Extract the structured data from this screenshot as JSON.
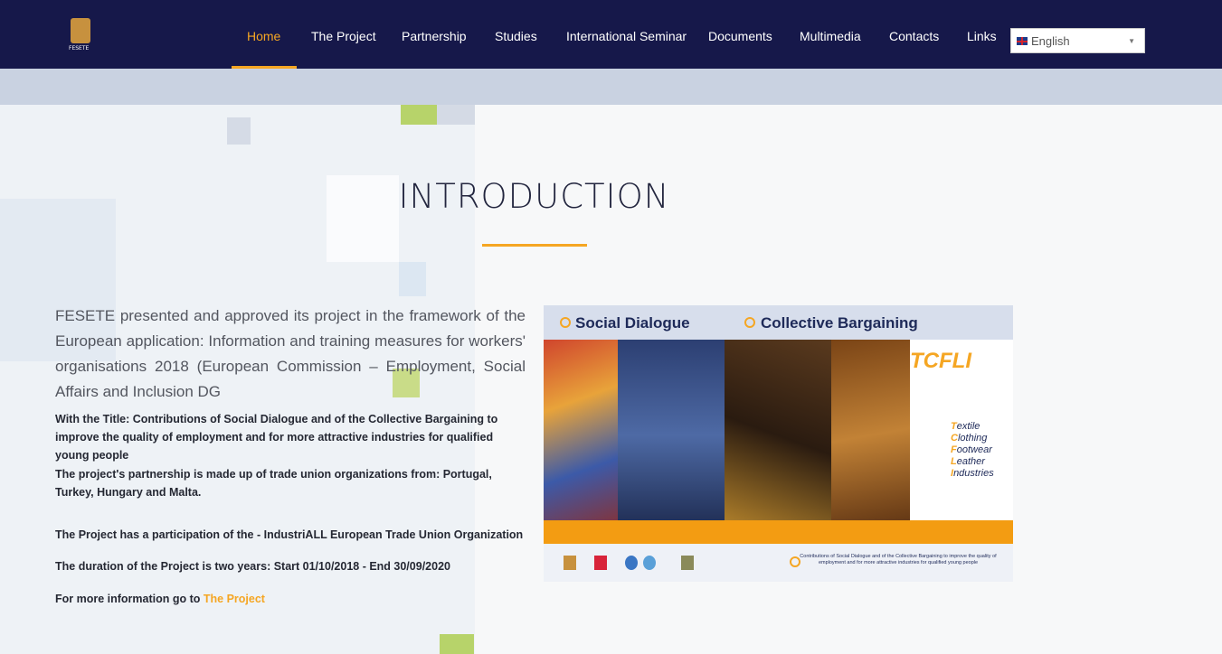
{
  "header": {
    "logo_text": "FESETE",
    "nav": [
      {
        "label": "Home",
        "active": true
      },
      {
        "label": "The Project"
      },
      {
        "label": "Partnership"
      },
      {
        "label": "Studies"
      },
      {
        "label": "International Seminar"
      },
      {
        "label": "Documents"
      },
      {
        "label": "Multimedia"
      },
      {
        "label": "Contacts"
      },
      {
        "label": "Links"
      }
    ],
    "language": {
      "selected": "English",
      "icon": "uk-flag-icon"
    }
  },
  "main": {
    "title": "INTRODUCTION",
    "intro": "FESETE presented and approved its project in the framework of the European application: Information and training measures for workers' organisations 2018 (European Commission – Employment, Social Affairs and Inclusion DG",
    "paragraphs": [
      "With the Title: Contributions of Social Dialogue and of the Collective Bargaining to improve the quality of employment and for more attractive industries for qualified young people",
      "The project's partnership is made up of trade union organizations from: Portugal, Turkey, Hungary and Malta.",
      "The Project has a participation of the - IndustriALL European Trade Union Organization",
      "The duration of the Project is two years: Start 01/10/2018 - End 30/09/2020"
    ],
    "more_info_prefix": "For more information go to ",
    "more_info_link": "The Project"
  },
  "banner": {
    "label_left": "Social Dialogue",
    "label_right": "Collective Bargaining",
    "acronym": "TCFLI",
    "sectors": [
      {
        "initial": "T",
        "rest": "extile"
      },
      {
        "initial": "C",
        "rest": "lothing"
      },
      {
        "initial": "F",
        "rest": "ootwear"
      },
      {
        "initial": "L",
        "rest": "eather"
      },
      {
        "initial": "I",
        "rest": "ndustries"
      }
    ],
    "footer_text": "Contributions of Social Dialogue and of the Collective Bargaining to improve the quality of employment and for more attractive industries for qualified young people"
  },
  "colors": {
    "navy": "#16184a",
    "accent": "#f5a623"
  }
}
